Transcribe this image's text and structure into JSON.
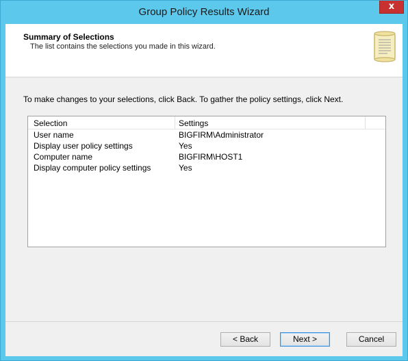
{
  "window": {
    "title": "Group Policy Results Wizard",
    "close_label": "x"
  },
  "header": {
    "title": "Summary of Selections",
    "subtitle": "The list contains the selections you made in this wizard."
  },
  "instruction": "To make changes to your selections, click Back. To gather the policy settings, click Next.",
  "list": {
    "columns": [
      "Selection",
      "Settings"
    ],
    "rows": [
      {
        "selection": "User name",
        "settings": "BIGFIRM\\Administrator"
      },
      {
        "selection": "Display user policy settings",
        "settings": "Yes"
      },
      {
        "selection": "Computer name",
        "settings": "BIGFIRM\\HOST1"
      },
      {
        "selection": "Display computer policy settings",
        "settings": "Yes"
      }
    ]
  },
  "buttons": {
    "back": "< Back",
    "next": "Next >",
    "cancel": "Cancel"
  },
  "colors": {
    "titlebar": "#5bc8ec",
    "close": "#c7312f",
    "client": "#f0f0f0"
  },
  "icons": {
    "header": "scroll-icon"
  }
}
